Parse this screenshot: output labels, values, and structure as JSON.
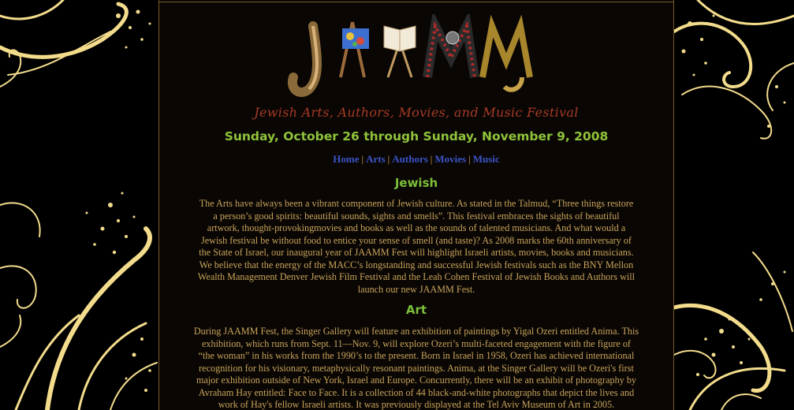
{
  "header": {
    "logo_text": "JAAMM",
    "tagline": "Jewish Arts, Authors, Movies, and Music Festival",
    "dates": "Sunday, October 26 through Sunday, November 9, 2008"
  },
  "nav": {
    "items": [
      "Home",
      "Arts",
      "Authors",
      "Movies",
      "Music"
    ],
    "separator": "|"
  },
  "sections": [
    {
      "heading": "Jewish",
      "lines": [
        "The Arts have always been a vibrant component of Jewish culture. As stated in the Talmud, “Three things restore",
        "a person’s good spirits: beautiful sounds, sights and smells”. This festival embraces the sights of beautiful",
        "artwork, thought-provokingmovies and books as well as the sounds of talented musicians. And what would a",
        "Jewish festival be without food to entice your sense of smell (and taste)? As 2008 marks the 60th anniversary of",
        "the State of Israel, our inaugural year of JAAMM Fest will highlight Israeli artists, movies, books and musicians.",
        "We believe that the energy of the MACC’s longstanding and successful Jewish festivals such as the BNY Mellon",
        "Wealth Management Denver Jewish Film Festival and the Leah Cohen Festival of Jewish Books and Authors will",
        "launch our new JAAMM Fest."
      ]
    },
    {
      "heading": "Art",
      "lines": [
        "During JAAMM Fest, the Singer Gallery will feature an exhibition of paintings by Yigal Ozeri entitled Anima. This",
        "exhibition, which runs from Sept. 11—Nov. 9, will explore Ozeri’s multi-faceted engagement with the figure of",
        "“the woman” in his works from the 1990’s to the present. Born in Israel in 1958, Ozeri has achieved international",
        "recognition for his visionary, metaphysically resonant paintings. Anima, at the Singer Gallery will be Ozeri's first",
        "major exhibition outside of New York, Israel and Europe. Concurrently, there will be an exhibit of photography by",
        "Avraham Hay entitled: Face to Face. It is a collection of 44 black-and-white photographs that depict the lives and",
        "work of Hay's fellow Israeli artists. It was previously displayed at the Tel Aviv Museum of Art in 2005."
      ]
    }
  ],
  "colors": {
    "tagline": "#a53a26",
    "dates": "#8fc43a",
    "heading": "#7cbf3a",
    "body": "#c8a55a",
    "nav_link": "#3b54c7",
    "swirl": "#f3dc8c"
  }
}
